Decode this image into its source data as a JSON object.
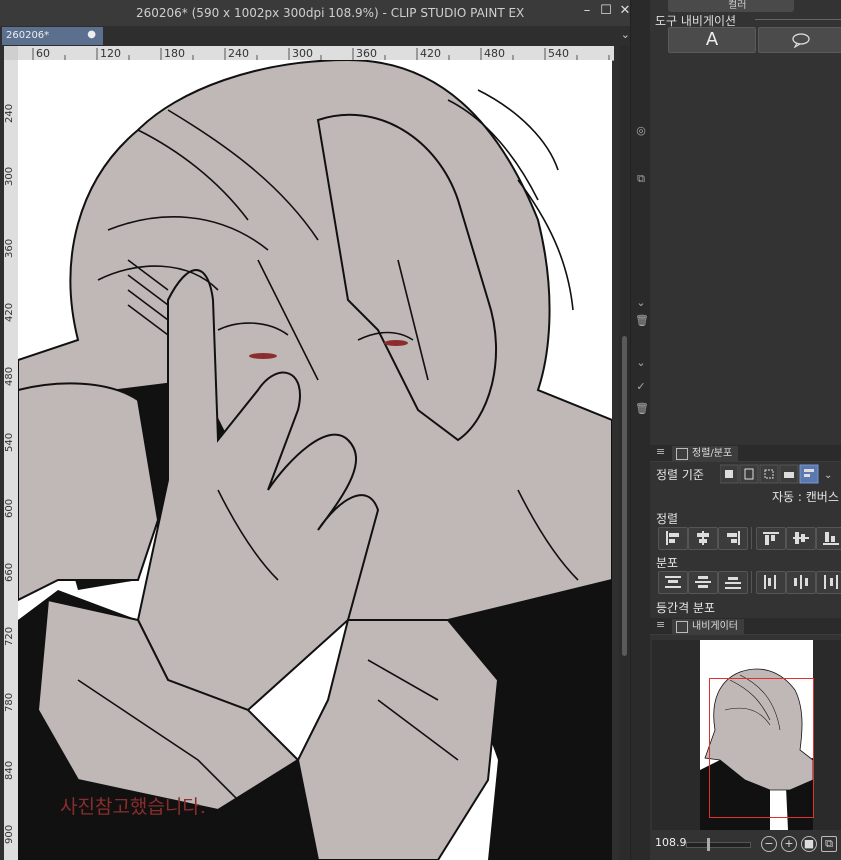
{
  "window": {
    "title": "260206* (590 x 1002px 300dpi 108.9%)  - CLIP STUDIO PAINT EX",
    "minimize": "–",
    "maximize": "☐",
    "close": "✕"
  },
  "tab": {
    "label": "260206*",
    "close_dot": "●",
    "chevron": "⌄"
  },
  "ruler": {
    "top": [
      "60",
      "120",
      "180",
      "240",
      "300",
      "360",
      "420",
      "480",
      "540"
    ],
    "left": [
      "240",
      "300",
      "360",
      "420",
      "480",
      "540",
      "600",
      "660",
      "720",
      "780",
      "840",
      "900"
    ]
  },
  "canvas": {
    "watermark": "사진참고했습니다."
  },
  "tool_nav": {
    "title": "도구 내비게이션",
    "top_partial": "컬러",
    "text_button": "A",
    "balloon_icon": "speech-balloon-icon"
  },
  "align_panel": {
    "tab": "정렬/분포",
    "basis_label": "정렬 기준",
    "auto_label": "자동 : 캔버스",
    "align_label": "정렬",
    "distribute_label": "분포",
    "spacing_label": "등간격 분포"
  },
  "navigator": {
    "tab": "내비게이터",
    "zoom": "108.9"
  },
  "colors": {
    "skin": "#c0b8b6",
    "ink": "#111111",
    "watermark": "#8b2d2d",
    "tab_active": "#5b6f8e",
    "frame": "#e03030"
  }
}
